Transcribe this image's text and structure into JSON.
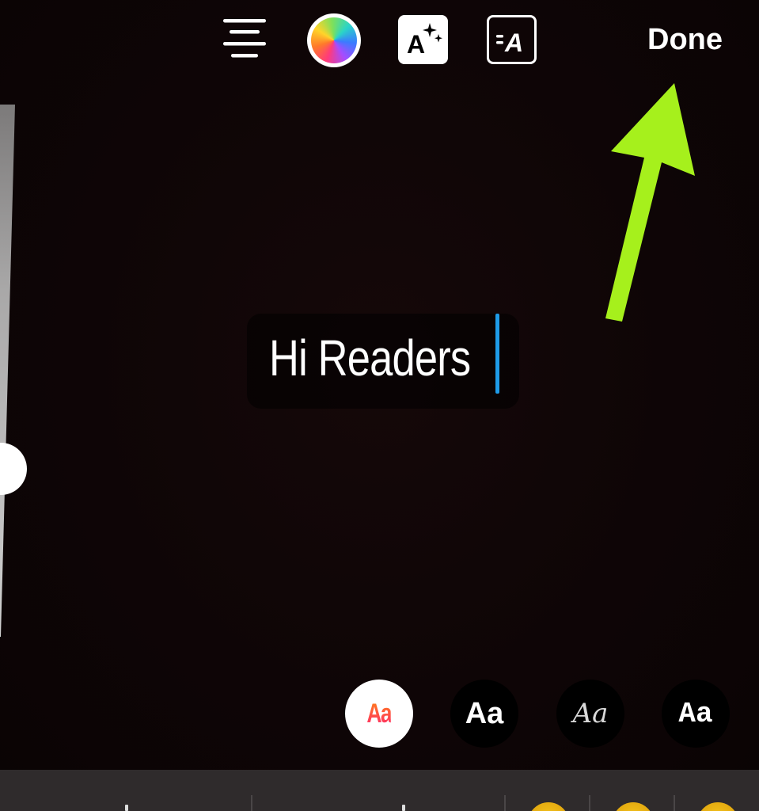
{
  "toolbar": {
    "align_icon": "align-center-icon",
    "color_icon": "color-wheel-icon",
    "effects_icon": "text-effects-sparkle-icon",
    "background_icon": "text-background-icon",
    "effects_label": "A",
    "background_label": "A",
    "done_label": "Done"
  },
  "editor": {
    "text": "Hi Readers",
    "caret_color": "#1e9be8"
  },
  "font_styles": [
    {
      "label": "Aa",
      "selected": true
    },
    {
      "label": "Aa",
      "selected": false
    },
    {
      "label": "Aa",
      "selected": false
    },
    {
      "label": "Aa",
      "selected": false
    }
  ],
  "annotation": {
    "arrow_color": "#a6f01c",
    "points_to": "done-button"
  },
  "colors": {
    "background": "#0d0506",
    "accent_green": "#a6f01c",
    "caret_blue": "#1e9be8"
  }
}
